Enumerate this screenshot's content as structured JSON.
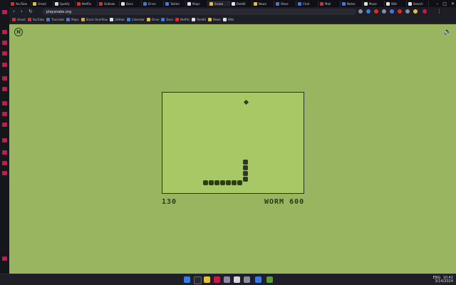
{
  "browser": {
    "address_url": "playsnake.org",
    "tabs": [
      {
        "title": "YouTube",
        "color": "#e02a2a"
      },
      {
        "title": "Gmail",
        "color": "#e0c23a"
      },
      {
        "title": "Spotify",
        "color": "#d6d6e0"
      },
      {
        "title": "Netflix",
        "color": "#e02a2a"
      },
      {
        "title": "Outlook",
        "color": "#e02a2a"
      },
      {
        "title": "Docs",
        "color": "#e0e0e0"
      },
      {
        "title": "Drive",
        "color": "#3a7be0"
      },
      {
        "title": "Twitter",
        "color": "#3a7be0"
      },
      {
        "title": "Maps",
        "color": "#e0e0e0"
      },
      {
        "title": "Snake",
        "color": "#e0c23a",
        "active": true
      },
      {
        "title": "Reddit",
        "color": "#e0e0e0"
      },
      {
        "title": "News",
        "color": "#e0c23a"
      },
      {
        "title": "Store",
        "color": "#3a7be0"
      },
      {
        "title": "Chat",
        "color": "#3a7be0"
      },
      {
        "title": "Mail",
        "color": "#e02a2a"
      },
      {
        "title": "Notes",
        "color": "#3a7be0"
      },
      {
        "title": "Music",
        "color": "#e0e0e0"
      },
      {
        "title": "Wiki",
        "color": "#e0e0e0"
      },
      {
        "title": "Search",
        "color": "#e0e0e0"
      }
    ],
    "bookmarks": [
      {
        "label": "Gmail",
        "color": "#e02a2a"
      },
      {
        "label": "YouTube",
        "color": "#e02a2a"
      },
      {
        "label": "Translate",
        "color": "#3a7be0"
      },
      {
        "label": "Maps",
        "color": "#3a7be0"
      },
      {
        "label": "Stack Overflow",
        "color": "#e0a23a"
      },
      {
        "label": "GitHub",
        "color": "#e0e0e0"
      },
      {
        "label": "Calendar",
        "color": "#3a7be0"
      },
      {
        "label": "Drive",
        "color": "#e0c23a"
      },
      {
        "label": "Docs",
        "color": "#3a7be0"
      },
      {
        "label": "Netflix",
        "color": "#e02a2a"
      },
      {
        "label": "Reddit",
        "color": "#e0e0e0"
      },
      {
        "label": "News",
        "color": "#e0c23a"
      },
      {
        "label": "Wiki",
        "color": "#e0e0e0"
      }
    ]
  },
  "game": {
    "score": "130",
    "mode": "WORM 600",
    "logo_letter": "N",
    "snake_color": "#2f3a1f",
    "board_color": "#a8c866",
    "page_color": "#9ab55f",
    "sound_icon": "speaker-icon"
  },
  "taskbar": {
    "time": "10:42",
    "date": "3/14/2024",
    "lang": "ENG"
  }
}
